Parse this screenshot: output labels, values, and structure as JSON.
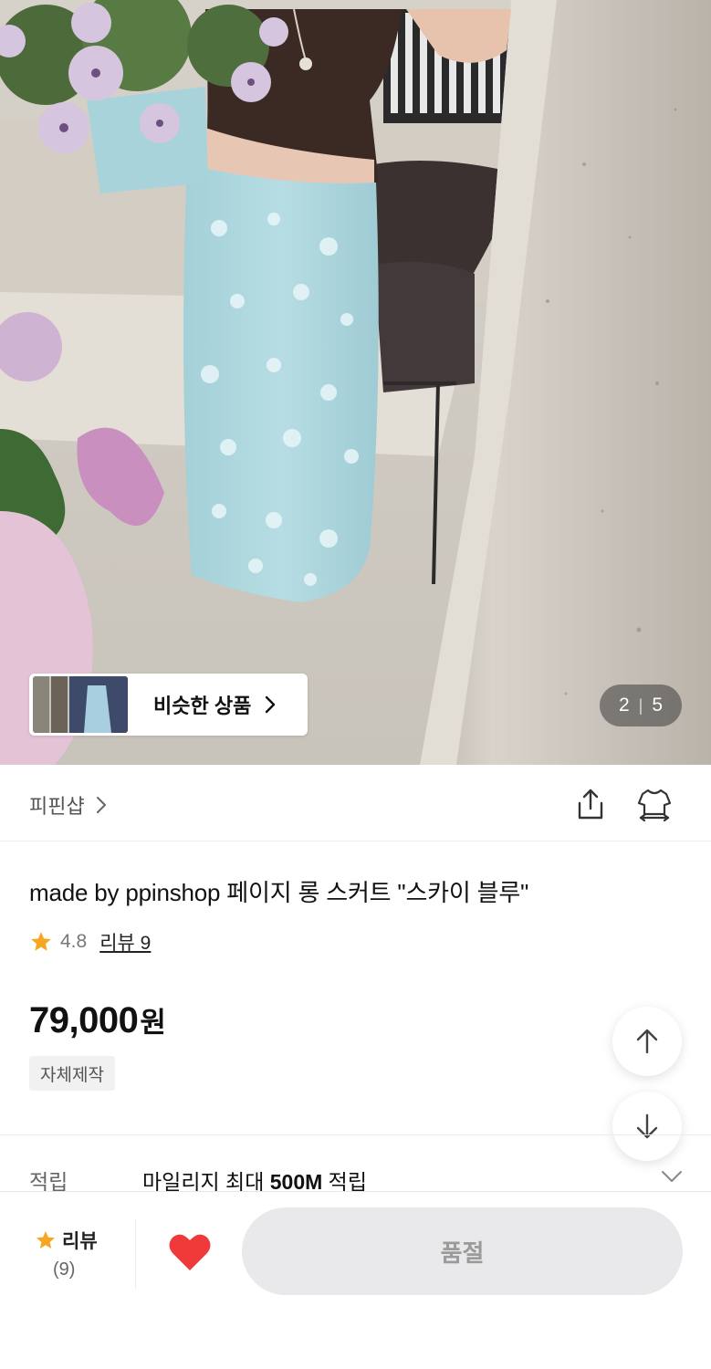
{
  "hero": {
    "similar_products_label": "비슷한 상품",
    "page_current": "2",
    "page_separator": "|",
    "page_total": "5"
  },
  "store": {
    "name": "피핀샵"
  },
  "product": {
    "title": "made by ppinshop 페이지 롱 스커트 \"스카이 블루\"",
    "rating": "4.8",
    "review_link": "리뷰 9",
    "price_number": "79,000",
    "price_unit": "원",
    "badge": "자체제작"
  },
  "mileage": {
    "label": "적립",
    "text_prefix": "마일리지 최대 ",
    "text_amount": "500M",
    "text_suffix": " 적립"
  },
  "bottom_bar": {
    "review_label": "리뷰",
    "review_count": "(9)",
    "soldout_label": "품절"
  },
  "colors": {
    "star": "#f5a623",
    "heart": "#f03a3a",
    "soldout_bg": "#e9e9eb",
    "skirt": "#a9d4dc"
  },
  "icons": [
    "chevron-right-icon",
    "share-icon",
    "closet-icon",
    "star-icon",
    "arrow-up-icon",
    "arrow-down-icon",
    "chevron-down-icon",
    "heart-icon"
  ]
}
